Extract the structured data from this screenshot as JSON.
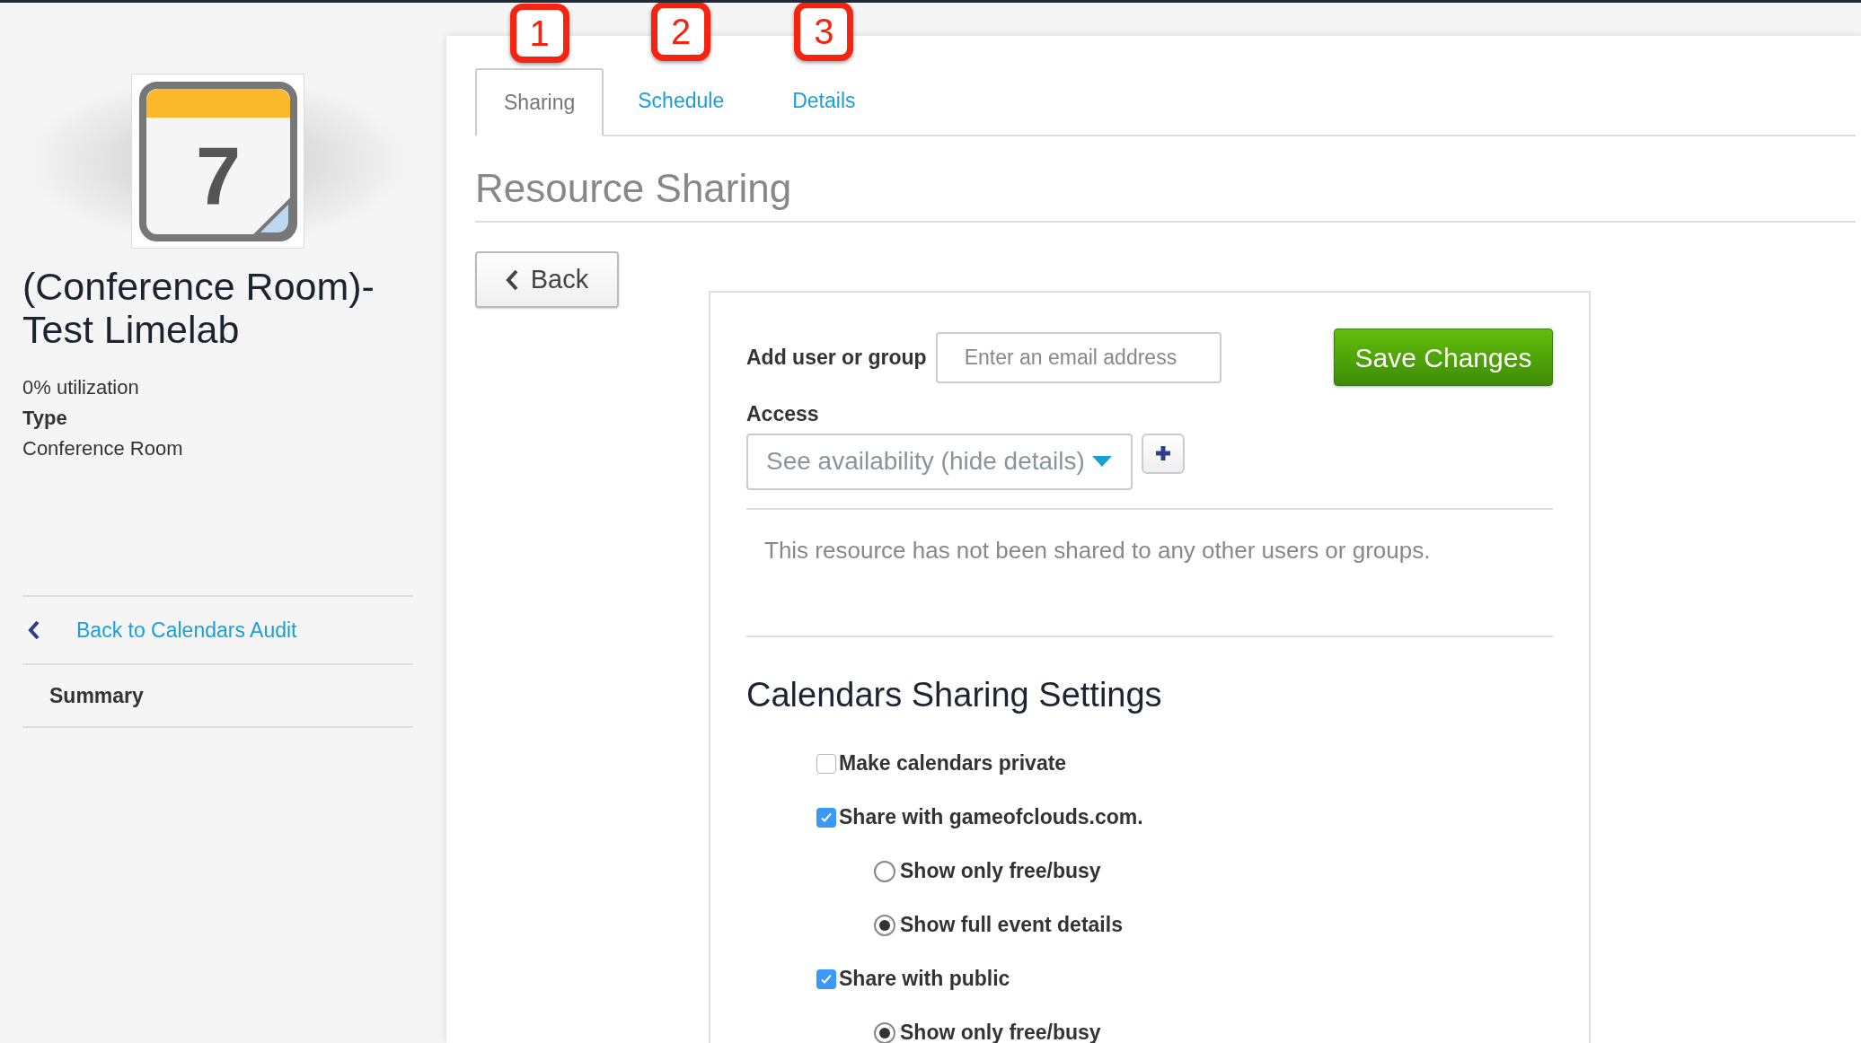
{
  "sidebar": {
    "calendar_day": "7",
    "title": "(Conference Room)-Test Limelab",
    "utilization": "0% utilization",
    "type_label": "Type",
    "type_value": "Conference Room",
    "nav": [
      {
        "kind": "back",
        "label": "Back to Calendars Audit"
      },
      {
        "kind": "item",
        "label": "Summary"
      }
    ]
  },
  "tabs": [
    {
      "label": "Sharing",
      "selected": true,
      "callout": "1"
    },
    {
      "label": "Schedule",
      "selected": false,
      "callout": "2"
    },
    {
      "label": "Details",
      "selected": false,
      "callout": "3"
    }
  ],
  "heading": "Resource Sharing",
  "back_button": "Back",
  "form": {
    "add_label": "Add user or group",
    "email_placeholder": "Enter an email address",
    "save_button": "Save Changes",
    "access_label": "Access",
    "access_value": "See availability (hide details)",
    "empty_message": "This resource has not been shared to any other users or groups."
  },
  "settings": {
    "title": "Calendars Sharing Settings",
    "options": [
      {
        "label": "Make calendars private",
        "checked": false
      },
      {
        "label": "Share with gameofclouds.com.",
        "checked": true,
        "children": [
          {
            "label": "Show only free/busy",
            "selected": false
          },
          {
            "label": "Show full event details",
            "selected": true
          }
        ]
      },
      {
        "label": "Share with public",
        "checked": true,
        "children": [
          {
            "label": "Show only free/busy",
            "selected": true
          }
        ]
      }
    ]
  }
}
